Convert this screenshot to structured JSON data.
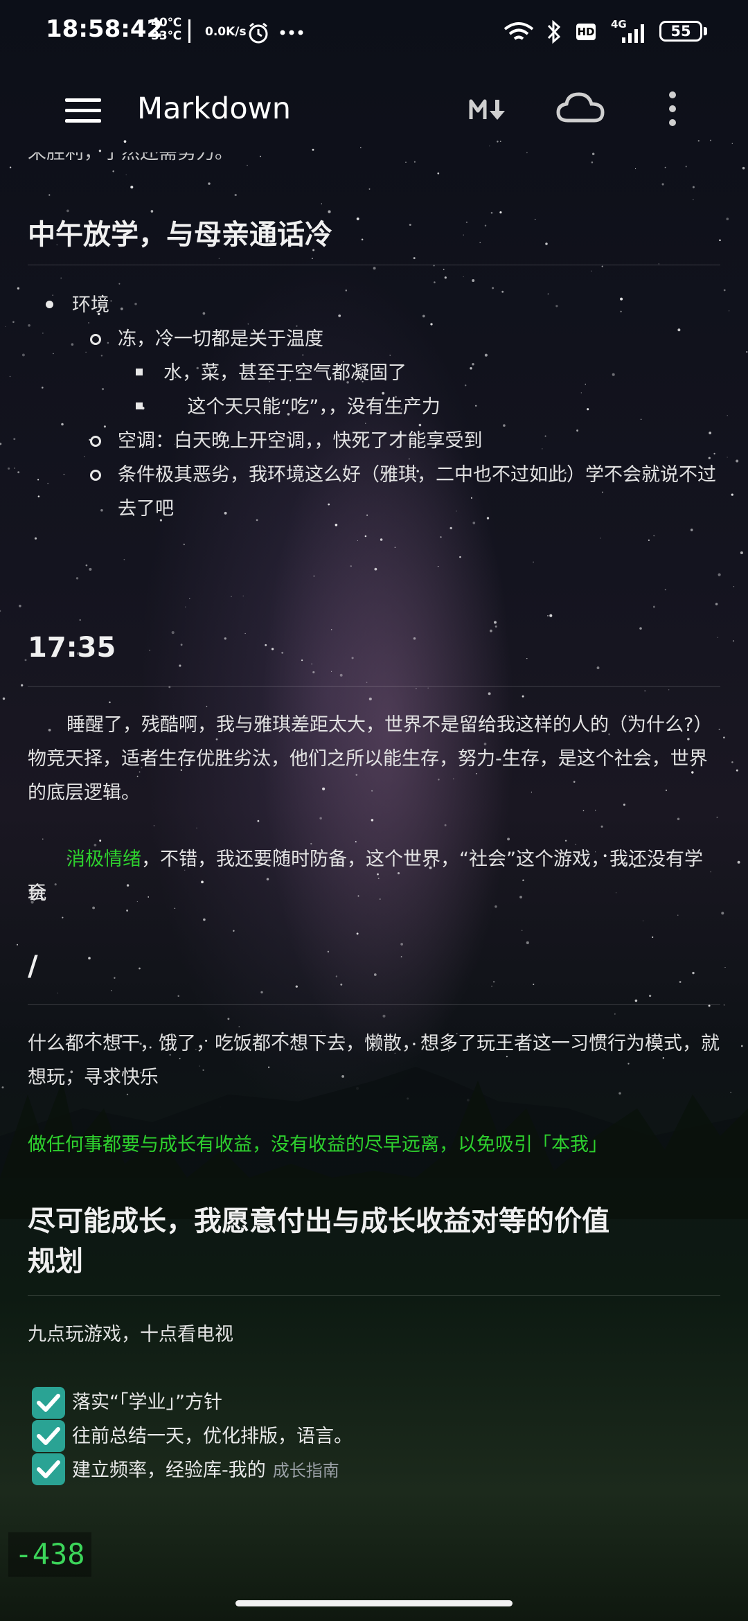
{
  "status_bar": {
    "time": "18:58:42",
    "temp_high": "40℃",
    "temp_low": "33℃",
    "net_speed": "0.0K/s",
    "signal": "4G",
    "battery": "55"
  },
  "app_bar": {
    "title": "Markdown",
    "markdown_icon": "M↓"
  },
  "document": {
    "clipped_top_text": "未胜利，于然还需努力。",
    "section1": {
      "heading": "中午放学，与母亲通话冷",
      "list": [
        {
          "level": 1,
          "text": "环境"
        },
        {
          "level": 2,
          "text": "冻，冷一切都是关于温度"
        },
        {
          "level": 3,
          "text": "水，菜，甚至于空气都凝固了"
        },
        {
          "level": 3,
          "text": "    这个天只能“吃”，，没有生产力"
        },
        {
          "level": 2,
          "text": "空调：白天晚上开空调，，快死了才能享受到"
        },
        {
          "level": 2,
          "text": "条件极其恶劣，我环境这么好（雅琪，二中也不过如此）学不会就说不过"
        },
        {
          "level": 2,
          "text": "去了吧"
        }
      ]
    },
    "section2": {
      "heading": "17:35",
      "para1_line1": "睡醒了，残酷啊，我与雅琪差距太大，世界不是留给我这样的人的（为什么?）",
      "para1_line2": "物竞天择，适者生存优胜劣汰，他们之所以能生存，努力-生存，是这个社会，世界",
      "para1_line3": "的底层逻辑。",
      "para2_green": "消极情绪",
      "para2_rest": "，不错，我还要随时防备，这个世界，“社会”这个游戏，我还没有学会",
      "para2_line2": "玩"
    },
    "section3": {
      "heading": "/",
      "para_line1": "什么都不想干，饿了，吃饭都不想下去，懒散，想多了玩王者这一习惯行为模式，就",
      "para_line2": "想玩，寻求快乐",
      "green_line": "做任何事都要与成长有收益，没有收益的尽早远离，以免吸引「本我」"
    },
    "section4": {
      "heading_line1": "尽可能成长，我愿意付出与成长收益对等的价值",
      "heading_line2": "规划",
      "para": "九点玩游戏，十点看电视",
      "tasks": [
        {
          "text": "落实“「学业」”方针",
          "checked": true,
          "link": ""
        },
        {
          "text": "往前总结一天，优化排版，语言。",
          "checked": true,
          "link": ""
        },
        {
          "text": "建立频率，经验库-我的",
          "checked": true,
          "link": "成长指南"
        }
      ]
    }
  },
  "overlay": {
    "counter": "-438"
  },
  "colors": {
    "accent_green": "#2ed12e",
    "checkbox": "#2aa394",
    "counter_text": "#3cd65a"
  }
}
